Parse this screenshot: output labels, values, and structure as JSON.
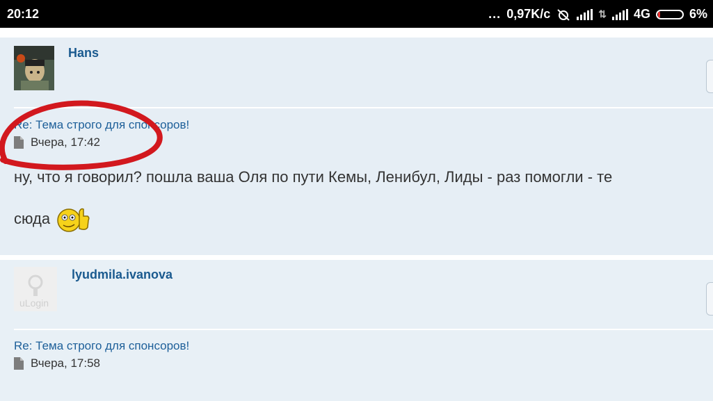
{
  "status_bar": {
    "time": "20:12",
    "dots": "...",
    "net_speed": "0,97K/c",
    "network": "4G",
    "battery": "6%",
    "battery_level": 0.06
  },
  "posts": [
    {
      "username": "Hans",
      "title": "Re: Тема строго для спонсоров!",
      "timestamp": "Вчера, 17:42",
      "text_line1": "ну, что я говорил? пошла ваша Оля по пути Кемы, Ленибул, Лиды - раз помогли - те",
      "text_line2": "сюда"
    },
    {
      "username": "lyudmila.ivanova",
      "avatar_label": "uLogin",
      "title": "Re: Тема строго для спонсоров!",
      "timestamp": "Вчера, 17:58"
    }
  ],
  "colors": {
    "link": "#1d5f99",
    "username": "#1a5a8f",
    "post_bg": "#e6eef5",
    "annotation": "#d2181e"
  }
}
